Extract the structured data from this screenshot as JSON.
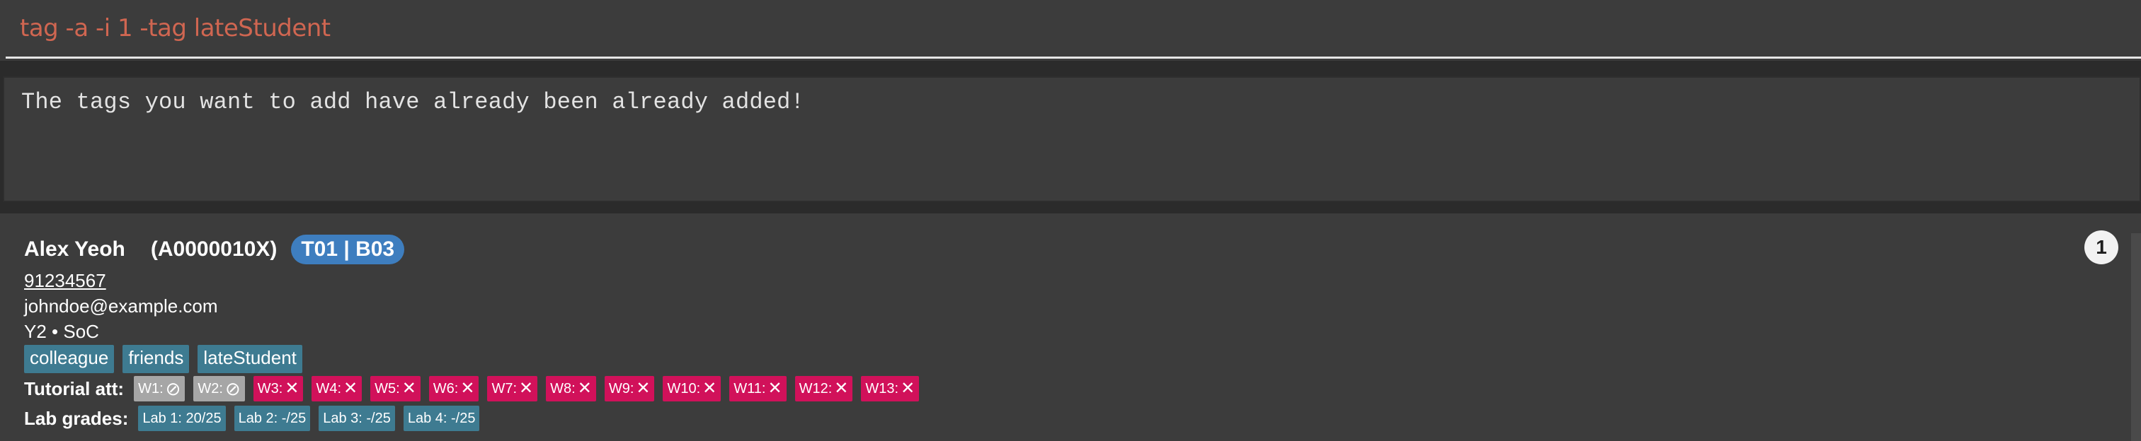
{
  "command_box": {
    "value": "tag -a -i 1 -tag lateStudent"
  },
  "result_display": {
    "message": "The tags you want to add have already been already added!"
  },
  "person_list": [
    {
      "index": "1",
      "name": "Alex Yeoh",
      "student_id": "(A0000010X)",
      "class": "T01 | B03",
      "phone": "91234567",
      "email": "johndoe@example.com",
      "year_faculty": "Y2 • SoC",
      "tags": [
        "colleague",
        "friends",
        "lateStudent"
      ],
      "tutorial_label": "Tutorial att:",
      "tutorial_attendance": [
        {
          "week": "W1:",
          "status": "excused",
          "symbol": "⊘"
        },
        {
          "week": "W2:",
          "status": "excused",
          "symbol": "⊘"
        },
        {
          "week": "W3:",
          "status": "absent",
          "symbol": "✕"
        },
        {
          "week": "W4:",
          "status": "absent",
          "symbol": "✕"
        },
        {
          "week": "W5:",
          "status": "absent",
          "symbol": "✕"
        },
        {
          "week": "W6:",
          "status": "absent",
          "symbol": "✕"
        },
        {
          "week": "W7:",
          "status": "absent",
          "symbol": "✕"
        },
        {
          "week": "W8:",
          "status": "absent",
          "symbol": "✕"
        },
        {
          "week": "W9:",
          "status": "absent",
          "symbol": "✕"
        },
        {
          "week": "W10:",
          "status": "absent",
          "symbol": "✕"
        },
        {
          "week": "W11:",
          "status": "absent",
          "symbol": "✕"
        },
        {
          "week": "W12:",
          "status": "absent",
          "symbol": "✕"
        },
        {
          "week": "W13:",
          "status": "absent",
          "symbol": "✕"
        }
      ],
      "lab_label": "Lab grades:",
      "lab_grades": [
        "Lab 1: 20/25",
        "Lab 2: -/25",
        "Lab 3: -/25",
        "Lab 4: -/25"
      ]
    }
  ],
  "colors": {
    "command_text": "#d06651",
    "class_badge": "#3e7ebf",
    "tag": "#3e7b91",
    "absent": "#d1115a",
    "excused": "#a6a6a6"
  }
}
